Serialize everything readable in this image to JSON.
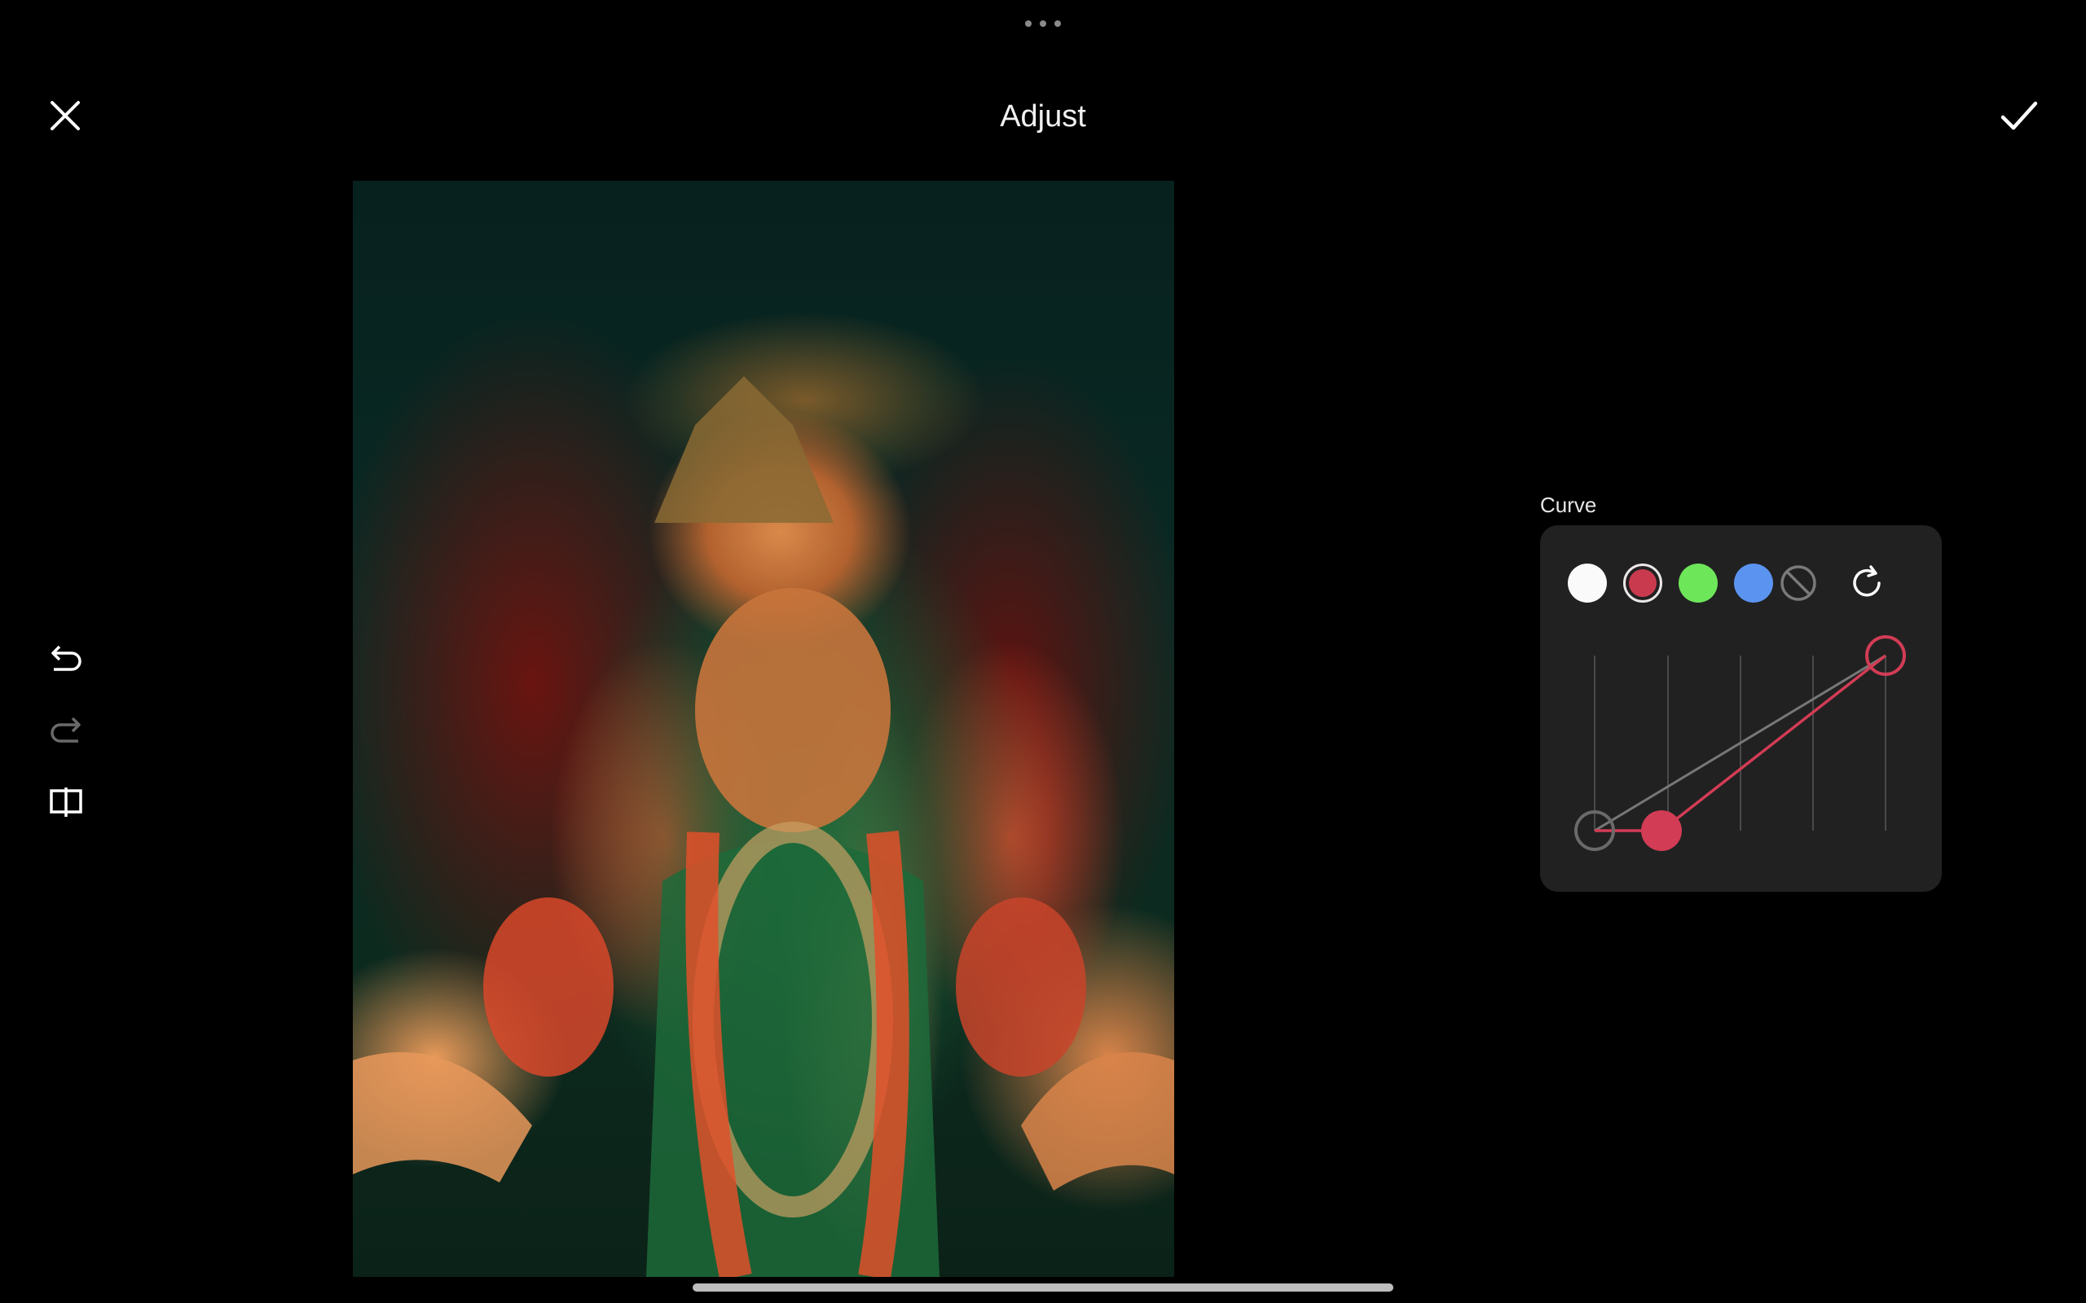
{
  "header": {
    "title": "Adjust",
    "more_icon": "more-horizontal-icon",
    "close_icon": "close-icon",
    "confirm_icon": "checkmark-icon"
  },
  "sidebar": {
    "undo_icon": "undo-icon",
    "redo_icon": "redo-icon",
    "compare_icon": "compare-icon",
    "redo_enabled": false
  },
  "photo": {
    "description_hidden": ""
  },
  "curve": {
    "label": "Curve",
    "channels": [
      {
        "name": "luminance",
        "color": "#fafafa"
      },
      {
        "name": "red",
        "color": "#c93a4e",
        "selected": true
      },
      {
        "name": "green",
        "color": "#6ee65a"
      },
      {
        "name": "blue",
        "color": "#5b94f0"
      }
    ],
    "disable_icon": "curve-disable-icon",
    "reset_icon": "reset-icon",
    "selected_channel": "red",
    "red_points": [
      [
        0.1,
        0.0
      ],
      [
        1.0,
        1.0
      ]
    ],
    "accent_color": "#d23c55"
  }
}
